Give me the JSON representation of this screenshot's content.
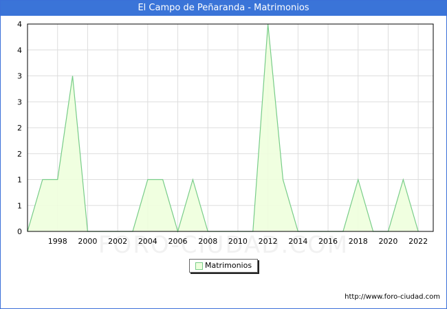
{
  "header": {
    "title": "El Campo de Peñaranda - Matrimonios"
  },
  "footer": {
    "source_url": "http://www.foro-ciudad.com"
  },
  "watermark": "FORO-CIUDAD.COM",
  "colors": {
    "title_bar": "#3a74d8",
    "area_fill": "#eeffdd",
    "area_line": "#77cc88",
    "grid": "#dddddd"
  },
  "chart_data": {
    "type": "area",
    "title": "El Campo de Peñaranda - Matrimonios",
    "xlabel": "",
    "ylabel": "",
    "x": [
      1996,
      1997,
      1998,
      1999,
      2000,
      2001,
      2002,
      2003,
      2004,
      2005,
      2006,
      2007,
      2008,
      2009,
      2010,
      2011,
      2012,
      2013,
      2014,
      2015,
      2016,
      2017,
      2018,
      2019,
      2020,
      2021,
      2022
    ],
    "series": [
      {
        "name": "Matrimonios",
        "values": [
          0,
          1,
          1,
          3,
          0,
          0,
          0,
          0,
          1,
          1,
          0,
          1,
          0,
          0,
          0,
          0,
          4,
          1,
          0,
          0,
          0,
          0,
          1,
          0,
          0,
          1,
          0
        ]
      }
    ],
    "xticks": [
      "1998",
      "2000",
      "2002",
      "2004",
      "2006",
      "2008",
      "2010",
      "2012",
      "2014",
      "2016",
      "2018",
      "2020",
      "2022"
    ],
    "yticks": [
      "0",
      "1",
      "1",
      "2",
      "2",
      "3",
      "3",
      "4",
      "4"
    ],
    "xlim": [
      1996,
      2023
    ],
    "ylim": [
      0,
      4
    ],
    "grid": true,
    "legend_position": "bottom"
  }
}
